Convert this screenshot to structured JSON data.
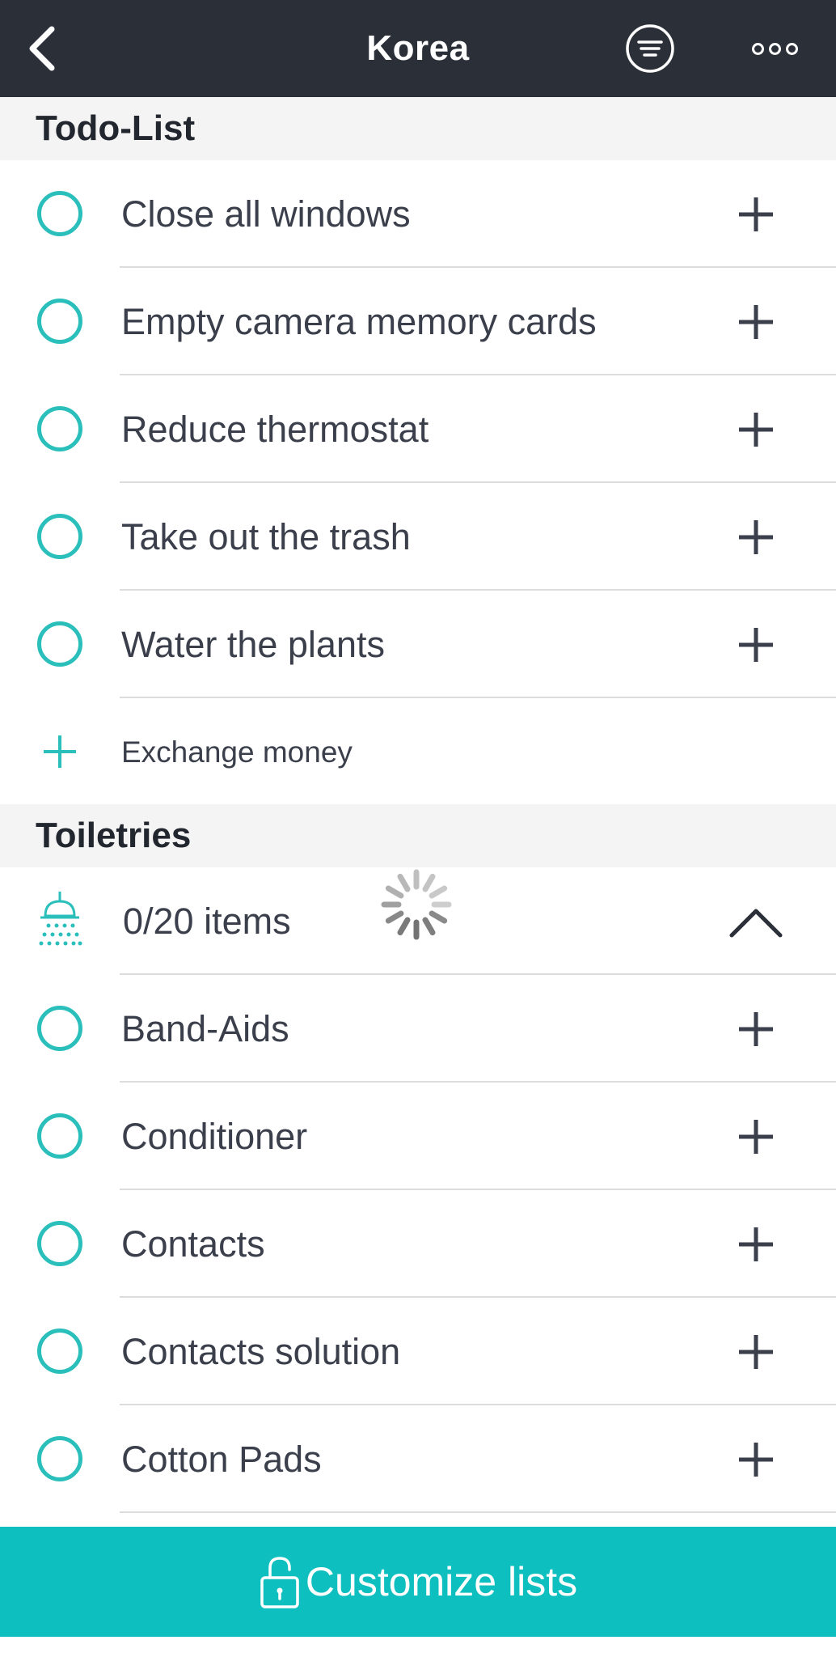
{
  "header": {
    "title": "Korea",
    "back_icon": "chevron-left-icon",
    "filter_icon": "list-filter-icon",
    "more_icon": "more-dots-icon"
  },
  "colors": {
    "header_bg": "#2b2f38",
    "accent": "#2bbfbc",
    "bar_bg": "#0dbfbf",
    "section_bg": "#f4f4f4"
  },
  "todo": {
    "title": "Todo-List",
    "items": [
      {
        "label": "Close all windows"
      },
      {
        "label": "Empty camera memory cards"
      },
      {
        "label": "Reduce thermostat"
      },
      {
        "label": "Take out the trash"
      },
      {
        "label": "Water the plants"
      }
    ],
    "add_item": "Exchange money"
  },
  "toiletries": {
    "title": "Toiletries",
    "summary": "0/20 items",
    "summary_icon": "shower-icon",
    "items": [
      {
        "label": "Band-Aids"
      },
      {
        "label": "Conditioner"
      },
      {
        "label": "Contacts"
      },
      {
        "label": "Contacts solution"
      },
      {
        "label": "Cotton Pads"
      }
    ]
  },
  "bottom_bar": {
    "label": "Customize lists",
    "icon": "unlock-icon"
  }
}
